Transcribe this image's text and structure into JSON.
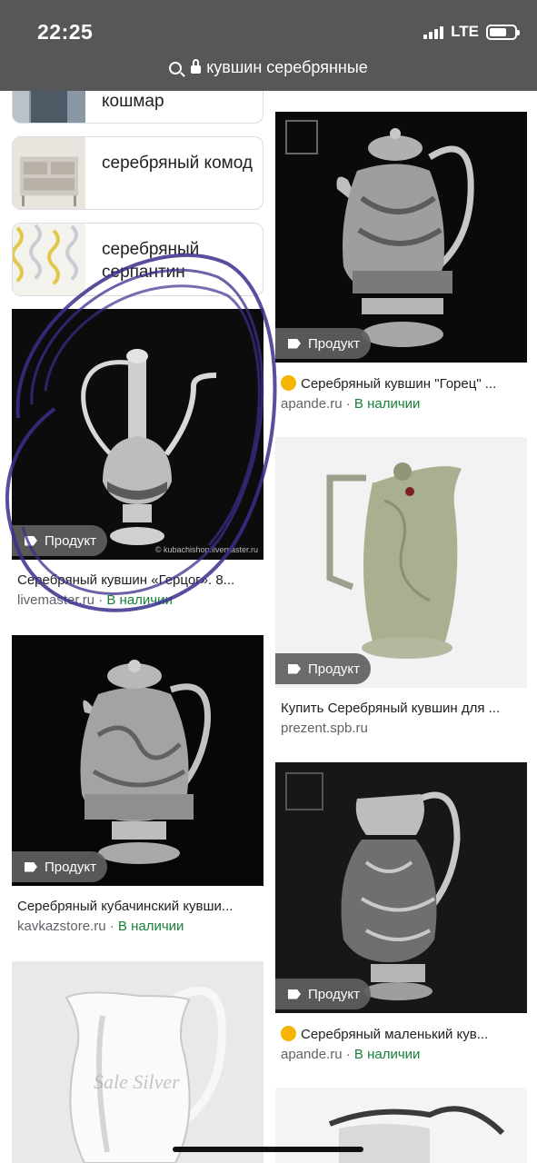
{
  "status_bar": {
    "time": "22:25",
    "network": "LTE"
  },
  "url_bar": {
    "query": "кувшин серебрянные"
  },
  "related": [
    {
      "label": "кошмар"
    },
    {
      "label": "серебряный комод"
    },
    {
      "label": "серебряный серпантин"
    }
  ],
  "results": [
    {
      "title": "Серебряный кувшин «Герцог». 8...",
      "source": "livemaster.ru",
      "stock": "В наличии",
      "badge": "Продукт",
      "watermark": "© kubachishop.livemaster.ru"
    },
    {
      "title": "Серебряный кувшин \"Горец\" ...",
      "source": "apande.ru",
      "stock": "В наличии",
      "badge": "Продукт"
    },
    {
      "title": "Купить Серебряный кувшин для ...",
      "source": "prezent.spb.ru",
      "stock": "",
      "badge": "Продукт"
    },
    {
      "title": "Серебряный кубачинский кувши...",
      "source": "kavkazstore.ru",
      "stock": "В наличии",
      "badge": "Продукт"
    },
    {
      "title": "Серебряный маленький кув...",
      "source": "apande.ru",
      "stock": "В наличии",
      "badge": "Продукт"
    },
    {
      "title": "",
      "source": "",
      "stock": "",
      "badge": "",
      "watermark": "Sale Silver"
    }
  ],
  "colors": {
    "header_bg": "#575757",
    "in_stock": "#188038",
    "badge_bg": "#5f5f5f",
    "annotation": "#3a2f8c"
  }
}
